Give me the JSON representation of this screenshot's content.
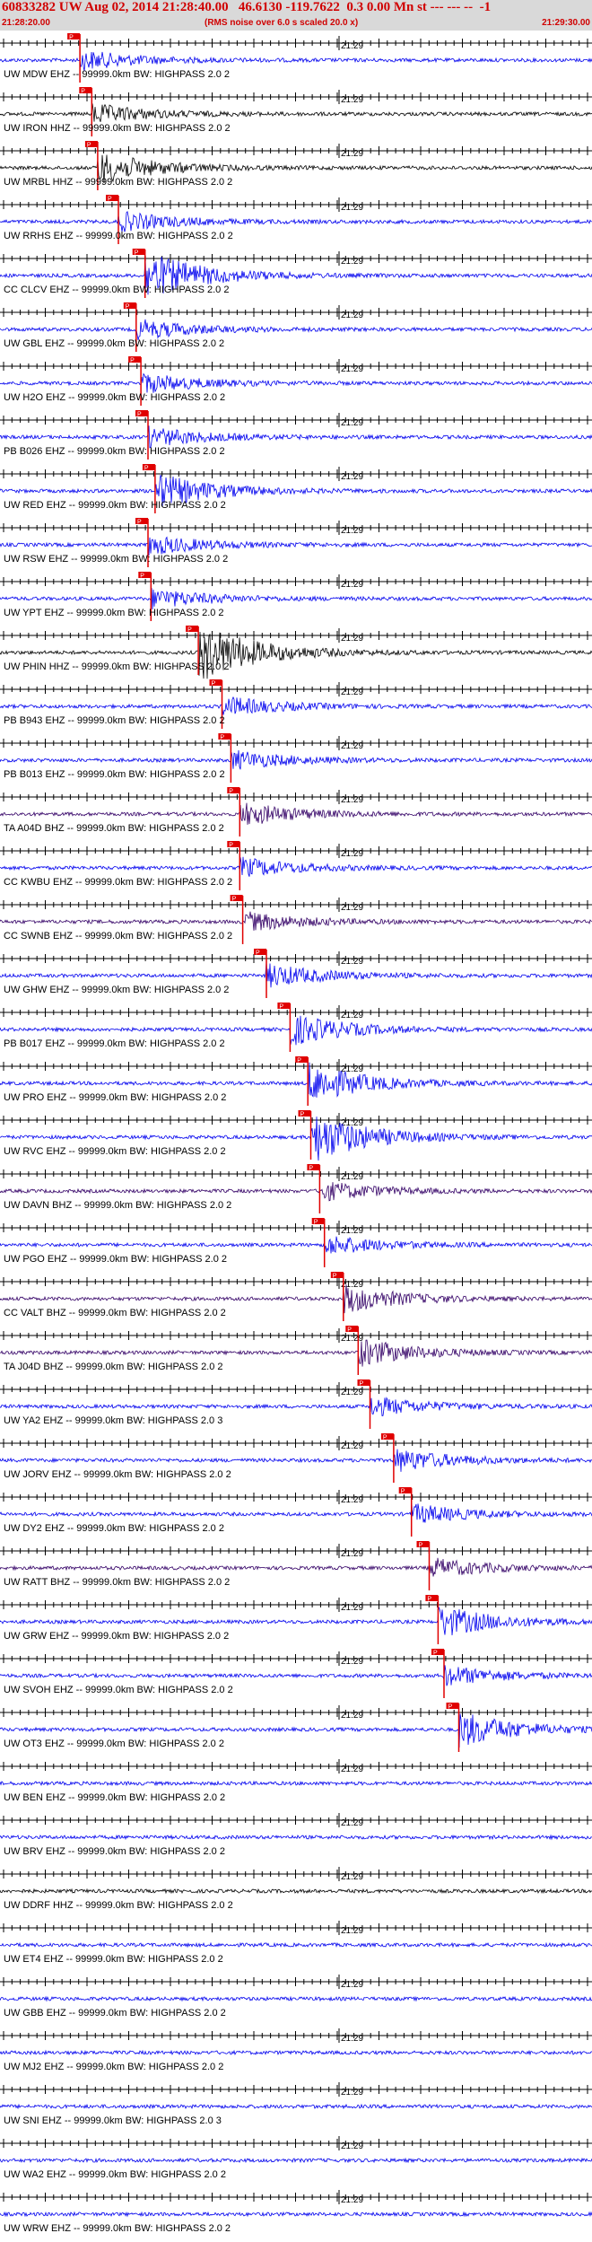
{
  "header": {
    "title": "60833282 UW Aug 02, 2014 21:28:40.00   46.6130 -119.7622  0.3 0.00 Mn st --- --- --  -1",
    "subtitle": "(RMS noise over 6.0 s scaled 20.0 x)",
    "time_start": "21:28:20.00",
    "time_end": "21:29:30.00"
  },
  "minute_label": "21:29",
  "pick_label": "P",
  "colors": {
    "header_bg": "#d9d9d9",
    "header_text": "#d00000",
    "pick": "#e00000",
    "blue": "#0000ee",
    "black": "#000000",
    "purple": "#330066"
  },
  "traces": [
    {
      "label": "UW MDW EHZ -- 99999.0km BW: HIGHPASS  2.0  2",
      "color": "blue",
      "pick": 0.135,
      "amp": 1.0
    },
    {
      "label": "UW IRON HHZ -- 99999.0km BW: HIGHPASS  2.0  2",
      "color": "black",
      "pick": 0.155,
      "amp": 1.0
    },
    {
      "label": "UW MRBL HHZ -- 99999.0km BW: HIGHPASS  2.0  2",
      "color": "black",
      "pick": 0.165,
      "amp": 1.6
    },
    {
      "label": "UW RRHS EHZ -- 99999.0km BW: HIGHPASS  2.0  2",
      "color": "blue",
      "pick": 0.2,
      "amp": 1.0
    },
    {
      "label": "CC CLCV EHZ -- 99999.0km BW: HIGHPASS  2.0  2",
      "color": "blue",
      "pick": 0.245,
      "amp": 2.4
    },
    {
      "label": "UW GBL EHZ -- 99999.0km BW: HIGHPASS  2.0  2",
      "color": "blue",
      "pick": 0.23,
      "amp": 1.0
    },
    {
      "label": "UW H2O EHZ -- 99999.0km BW: HIGHPASS  2.0  2",
      "color": "blue",
      "pick": 0.238,
      "amp": 1.0
    },
    {
      "label": "PB B026 EHZ -- 99999.0km BW: HIGHPASS  2.0  2",
      "color": "blue",
      "pick": 0.25,
      "amp": 1.0
    },
    {
      "label": "UW RED EHZ -- 99999.0km BW: HIGHPASS  2.0  2",
      "color": "blue",
      "pick": 0.262,
      "amp": 1.8
    },
    {
      "label": "UW RSW EHZ -- 99999.0km BW: HIGHPASS  2.0  2",
      "color": "blue",
      "pick": 0.25,
      "amp": 1.0
    },
    {
      "label": "UW YPT EHZ -- 99999.0km BW: HIGHPASS  2.0  2",
      "color": "blue",
      "pick": 0.255,
      "amp": 1.0
    },
    {
      "label": "UW PHIN HHZ -- 99999.0km BW: HIGHPASS  2.0  2",
      "color": "black",
      "pick": 0.335,
      "amp": 3.0
    },
    {
      "label": "PB B943 EHZ -- 99999.0km BW: HIGHPASS  2.0  2",
      "color": "blue",
      "pick": 0.375,
      "amp": 1.0
    },
    {
      "label": "PB B013 EHZ -- 99999.0km BW: HIGHPASS  2.0  2",
      "color": "blue",
      "pick": 0.39,
      "amp": 1.0
    },
    {
      "label": "TA A04D BHZ -- 99999.0km BW: HIGHPASS  2.0  2",
      "color": "purple",
      "pick": 0.405,
      "amp": 1.2
    },
    {
      "label": "CC KWBU EHZ -- 99999.0km BW: HIGHPASS  2.0  2",
      "color": "blue",
      "pick": 0.405,
      "amp": 1.0
    },
    {
      "label": "CC SWNB EHZ -- 99999.0km BW: HIGHPASS  2.0  2",
      "color": "purple",
      "pick": 0.41,
      "amp": 1.0
    },
    {
      "label": "UW GHW EHZ -- 99999.0km BW: HIGHPASS  2.0  2",
      "color": "blue",
      "pick": 0.45,
      "amp": 1.2
    },
    {
      "label": "PB B017 EHZ -- 99999.0km BW: HIGHPASS  2.0  2",
      "color": "blue",
      "pick": 0.49,
      "amp": 1.6
    },
    {
      "label": "UW PRO EHZ -- 99999.0km BW: HIGHPASS  2.0  2",
      "color": "blue",
      "pick": 0.52,
      "amp": 2.0
    },
    {
      "label": "UW RVC EHZ -- 99999.0km BW: HIGHPASS  2.0  2",
      "color": "blue",
      "pick": 0.525,
      "amp": 2.6
    },
    {
      "label": "UW DAVN BHZ -- 99999.0km BW: HIGHPASS  2.0  2",
      "color": "purple",
      "pick": 0.54,
      "amp": 1.0
    },
    {
      "label": "UW PGO EHZ -- 99999.0km BW: HIGHPASS  2.0  2",
      "color": "blue",
      "pick": 0.548,
      "amp": 1.0
    },
    {
      "label": "CC VALT BHZ -- 99999.0km BW: HIGHPASS  2.0  2",
      "color": "purple",
      "pick": 0.58,
      "amp": 1.4
    },
    {
      "label": "TA J04D BHZ -- 99999.0km BW: HIGHPASS  2.0  2",
      "color": "purple",
      "pick": 0.605,
      "amp": 1.4
    },
    {
      "label": "UW YA2 EHZ -- 99999.0km BW: HIGHPASS  2.0  3",
      "color": "blue",
      "pick": 0.625,
      "amp": 1.0
    },
    {
      "label": "UW JORV EHZ -- 99999.0km BW: HIGHPASS  2.0  2",
      "color": "blue",
      "pick": 0.665,
      "amp": 1.2
    },
    {
      "label": "UW DY2 EHZ -- 99999.0km BW: HIGHPASS  2.0  2",
      "color": "blue",
      "pick": 0.695,
      "amp": 1.0
    },
    {
      "label": "UW RATT BHZ -- 99999.0km BW: HIGHPASS  2.0  2",
      "color": "purple",
      "pick": 0.725,
      "amp": 1.0
    },
    {
      "label": "UW GRW EHZ -- 99999.0km BW: HIGHPASS  2.0  2",
      "color": "blue",
      "pick": 0.74,
      "amp": 1.6
    },
    {
      "label": "UW SVOH EHZ -- 99999.0km BW: HIGHPASS  2.0  2",
      "color": "blue",
      "pick": 0.75,
      "amp": 1.0
    },
    {
      "label": "UW OT3 EHZ -- 99999.0km BW: HIGHPASS  2.0  2",
      "color": "blue",
      "pick": 0.775,
      "amp": 1.8
    },
    {
      "label": "UW BEN EHZ -- 99999.0km BW: HIGHPASS  2.0  2",
      "color": "blue",
      "pick": null,
      "amp": 1.0
    },
    {
      "label": "UW BRV EHZ -- 99999.0km BW: HIGHPASS  2.0  2",
      "color": "blue",
      "pick": null,
      "amp": 1.0
    },
    {
      "label": "UW DDRF HHZ -- 99999.0km BW: HIGHPASS  2.0  2",
      "color": "black",
      "pick": null,
      "amp": 1.0
    },
    {
      "label": "UW ET4 EHZ -- 99999.0km BW: HIGHPASS  2.0  2",
      "color": "blue",
      "pick": null,
      "amp": 1.0
    },
    {
      "label": "UW GBB EHZ -- 99999.0km BW: HIGHPASS  2.0  2",
      "color": "blue",
      "pick": null,
      "amp": 1.0
    },
    {
      "label": "UW MJ2 EHZ -- 99999.0km BW: HIGHPASS  2.0  2",
      "color": "blue",
      "pick": null,
      "amp": 1.0
    },
    {
      "label": "UW SNI EHZ -- 99999.0km BW: HIGHPASS  2.0  3",
      "color": "blue",
      "pick": null,
      "amp": 1.0
    },
    {
      "label": "UW WA2 EHZ -- 99999.0km BW: HIGHPASS  2.0  2",
      "color": "blue",
      "pick": null,
      "amp": 1.0
    },
    {
      "label": "UW WRW EHZ -- 99999.0km BW: HIGHPASS  2.0  2",
      "color": "blue",
      "pick": null,
      "amp": 1.0
    }
  ]
}
